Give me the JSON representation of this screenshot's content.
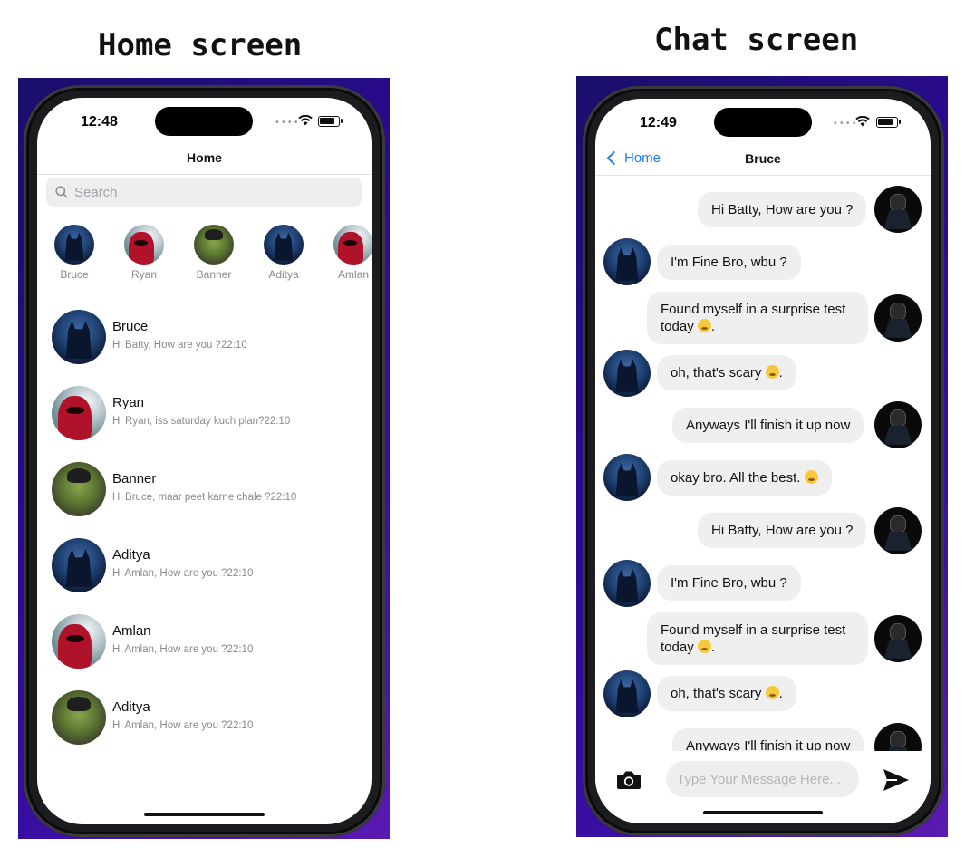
{
  "captions": {
    "home": "Home screen",
    "chat": "Chat screen"
  },
  "home": {
    "status_time": "12:48",
    "nav_title": "Home",
    "search_placeholder": "Search",
    "stories": [
      {
        "name": "Bruce",
        "avatar": "batman-avatar"
      },
      {
        "name": "Ryan",
        "avatar": "deadpool-avatar"
      },
      {
        "name": "Banner",
        "avatar": "hulk-avatar"
      },
      {
        "name": "Aditya",
        "avatar": "batman-avatar"
      },
      {
        "name": "Amlan",
        "avatar": "deadpool-avatar"
      }
    ],
    "conversations": [
      {
        "name": "Bruce",
        "preview": "Hi Batty, How are you ?22:10",
        "avatar": "batman-avatar"
      },
      {
        "name": "Ryan",
        "preview": "Hi Ryan, iss saturday kuch plan?22:10",
        "avatar": "deadpool-avatar"
      },
      {
        "name": "Banner",
        "preview": "Hi Bruce, maar peet karne chale ?22:10",
        "avatar": "hulk-avatar"
      },
      {
        "name": "Aditya",
        "preview": "Hi Amlan, How are you ?22:10",
        "avatar": "batman-avatar"
      },
      {
        "name": "Amlan",
        "preview": "Hi Amlan, How are you ?22:10",
        "avatar": "deadpool-avatar"
      },
      {
        "name": "Aditya",
        "preview": "Hi Amlan, How are you ?22:10",
        "avatar": "hulk-avatar"
      }
    ]
  },
  "chat": {
    "status_time": "12:49",
    "back_label": "Home",
    "nav_title": "Bruce",
    "messages": [
      {
        "side": "sent",
        "line1": "Hi Batty, How are you ?",
        "line2": "",
        "emoji": ""
      },
      {
        "side": "received",
        "line1": "I'm Fine Bro, wbu ?",
        "line2": "",
        "emoji": ""
      },
      {
        "side": "sent",
        "line1": "Found myself in a surprise test",
        "line2": "today",
        "emoji": "sad-sweat-emoji"
      },
      {
        "side": "received",
        "line1": "oh, that's scary",
        "line2": "",
        "emoji": "hushed-emoji"
      },
      {
        "side": "sent",
        "line1": "Anyways I'll finish it up now",
        "line2": "",
        "emoji": ""
      },
      {
        "side": "received",
        "line1": "okay bro. All the best.",
        "line2": "",
        "emoji": "party-emoji"
      },
      {
        "side": "sent",
        "line1": "Hi Batty, How are you ?",
        "line2": "",
        "emoji": ""
      },
      {
        "side": "received",
        "line1": "I'm Fine Bro, wbu ?",
        "line2": "",
        "emoji": ""
      },
      {
        "side": "sent",
        "line1": "Found myself in a surprise test",
        "line2": "today",
        "emoji": "sad-sweat-emoji"
      },
      {
        "side": "received",
        "line1": "oh, that's scary",
        "line2": "",
        "emoji": "hushed-emoji"
      },
      {
        "side": "sent",
        "line1": "Anyways I'll finish it up now",
        "line2": "",
        "emoji": ""
      }
    ],
    "input_placeholder": "Type Your Message Here...",
    "camera_icon": "camera-icon",
    "send_icon": "send-icon"
  },
  "colors": {
    "accent": "#1a7cf5",
    "bubble": "#efeff0",
    "wallpaper": "#2a0a8f"
  }
}
